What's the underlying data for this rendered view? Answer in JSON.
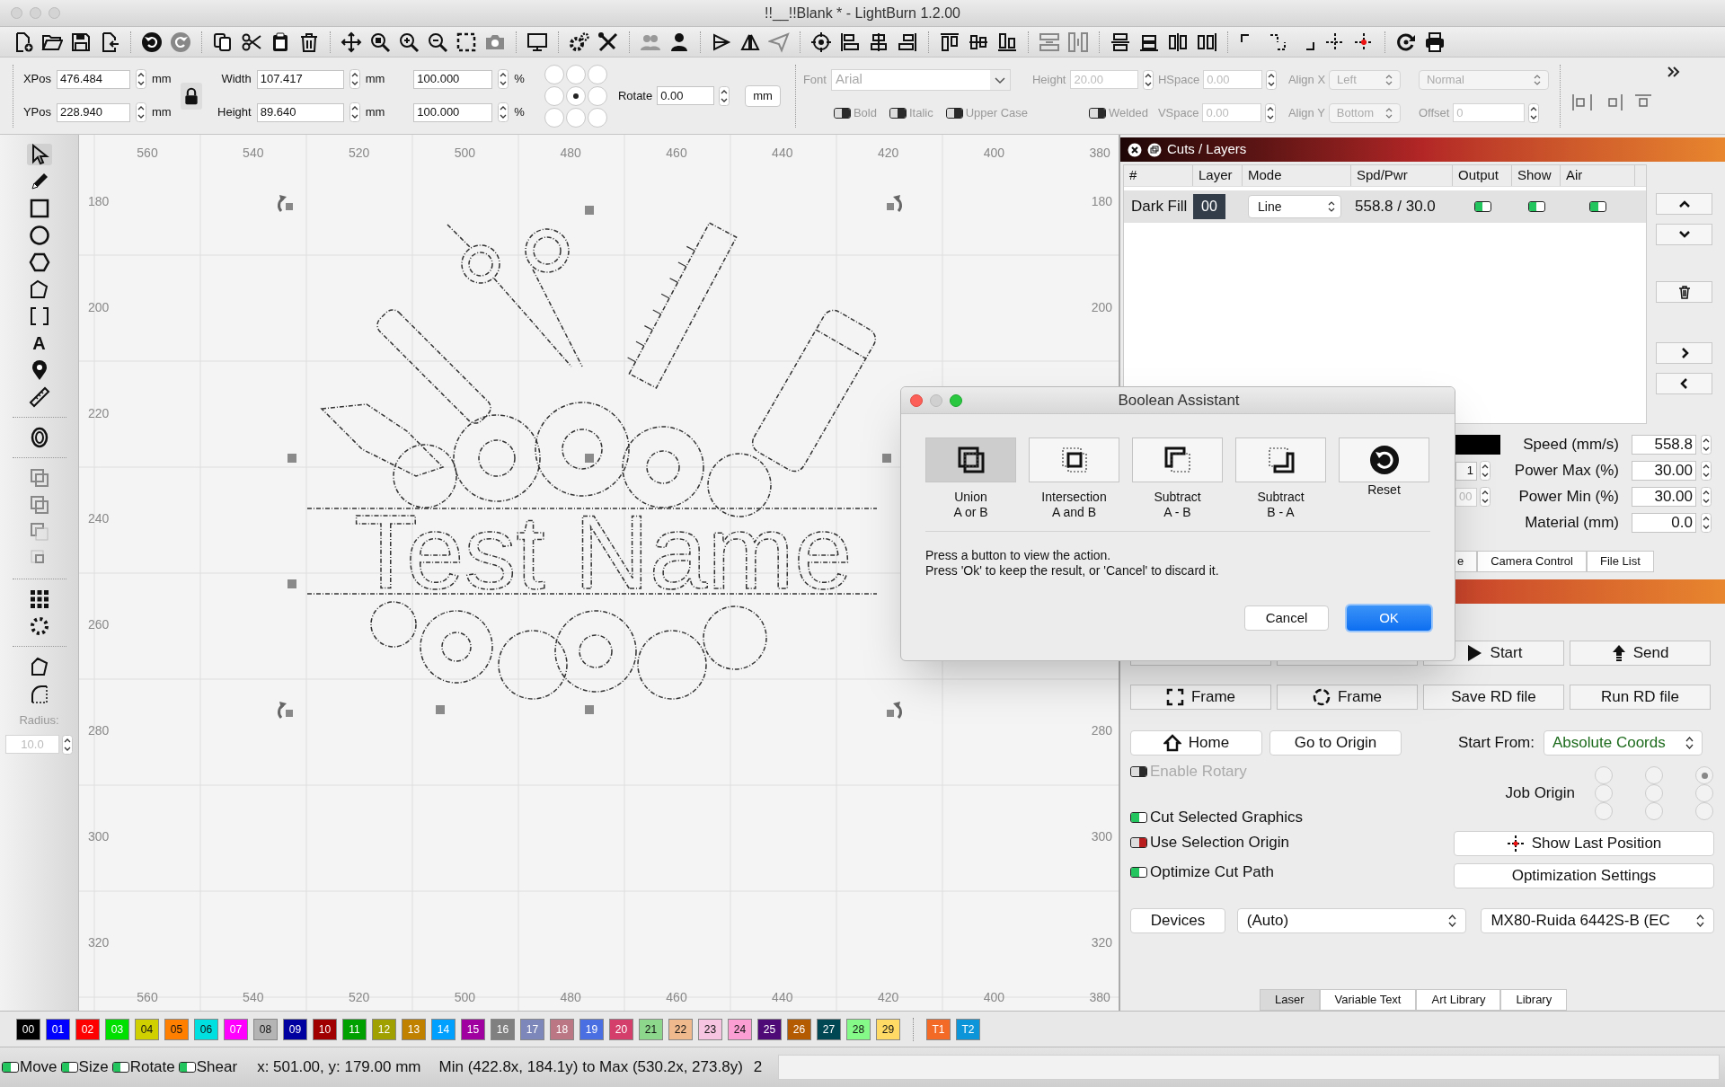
{
  "window": {
    "title": "!!__!!Blank * - LightBurn 1.2.00"
  },
  "position": [
    {
      "label": "XPos",
      "value": "476.484",
      "unit": "mm"
    },
    {
      "label": "YPos",
      "value": "228.940",
      "unit": "mm"
    }
  ],
  "size_locked": true,
  "size": [
    {
      "label": "Width",
      "value": "107.417",
      "unit": "mm",
      "scale": "100.000",
      "scale_unit": "%"
    },
    {
      "label": "Height",
      "value": "89.640",
      "unit": "mm",
      "scale": "100.000",
      "scale_unit": "%"
    }
  ],
  "origin_points": [
    {
      "selected": false
    },
    {
      "selected": false
    },
    {
      "selected": false
    },
    {
      "selected": false
    },
    {
      "selected": true
    },
    {
      "selected": false
    },
    {
      "selected": false
    },
    {
      "selected": false
    },
    {
      "selected": false
    }
  ],
  "rotate": {
    "label": "Rotate",
    "value": "0.00"
  },
  "units_button": "mm",
  "text_tools": {
    "font": {
      "label": "Font",
      "value": "Arial"
    },
    "height": {
      "label": "Height",
      "value": "20.00"
    },
    "hspace": {
      "label": "HSpace",
      "value": "0.00"
    },
    "align_x": {
      "label": "Align X",
      "value": "Left"
    },
    "style": "Normal",
    "toggles": [
      {
        "label": "Bold",
        "on": false
      },
      {
        "label": "Italic",
        "on": false
      },
      {
        "label": "Upper Case",
        "on": false
      },
      {
        "label": "Welded",
        "on": false
      }
    ],
    "vspace": {
      "label": "VSpace",
      "value": "0.00"
    },
    "align_y": {
      "label": "Align Y",
      "value": "Bottom"
    },
    "offset": {
      "label": "Offset",
      "value": "0"
    }
  },
  "left_tools": {
    "text_tool": "A",
    "radius": {
      "label": "Radius:",
      "value": "10.0"
    }
  },
  "canvas": {
    "top_ruler": [
      "560",
      "540",
      "520",
      "500",
      "480",
      "460",
      "440",
      "420",
      "400",
      "380"
    ],
    "bottom_ruler": [
      "560",
      "540",
      "520",
      "500",
      "480",
      "460",
      "440",
      "420",
      "400",
      "380"
    ],
    "left_ruler": [
      "180",
      "200",
      "220",
      "240",
      "260",
      "280",
      "300",
      "320"
    ],
    "right_ruler_upper": [
      "180",
      "200"
    ],
    "right_ruler_lower": [
      "280",
      "300",
      "320"
    ],
    "artwork_text": "Test Name"
  },
  "cuts_layers": {
    "title": "Cuts / Layers",
    "columns": [
      "#",
      "Layer",
      "Mode",
      "Spd/Pwr",
      "Output",
      "Show",
      "Air"
    ],
    "rows": [
      {
        "name": "Dark Fill",
        "layer": "00",
        "mode": "Line",
        "spd_pwr": "558.8 / 30.0",
        "output": true,
        "show": true,
        "air": true,
        "selected": true
      }
    ]
  },
  "layer_settings": {
    "passes": "1",
    "partial": "00",
    "fields": [
      {
        "label": "Speed (mm/s)",
        "value": "558.8"
      },
      {
        "label": "Power Max (%)",
        "value": "30.00"
      },
      {
        "label": "Power Min (%)",
        "value": "30.00"
      },
      {
        "label": "Material (mm)",
        "value": "0.0"
      }
    ]
  },
  "panel_tabs": [
    {
      "label": "e",
      "selected": false
    },
    {
      "label": "Camera Control",
      "selected": false
    },
    {
      "label": "File List",
      "selected": false
    }
  ],
  "laser": {
    "row1": [
      {
        "kind": "start",
        "label": "Start"
      },
      {
        "kind": "send",
        "label": "Send"
      }
    ],
    "row2": [
      {
        "kind": "frame-rect",
        "label": "Frame"
      },
      {
        "kind": "frame-circle",
        "label": "Frame"
      },
      {
        "kind": "plain",
        "label": "Save RD file"
      },
      {
        "kind": "plain",
        "label": "Run RD file"
      }
    ],
    "home": "Home",
    "go_to_origin": "Go to Origin",
    "start_from": {
      "label": "Start From:",
      "value": "Absolute Coords"
    },
    "enable_rotary": {
      "label": "Enable Rotary",
      "on": false,
      "disabled": true
    },
    "job_origin": {
      "label": "Job Origin",
      "points": [
        {
          "selected": false
        },
        {
          "selected": false
        },
        {
          "selected": true
        },
        {
          "selected": false
        },
        {
          "selected": false
        },
        {
          "selected": false
        },
        {
          "selected": false
        },
        {
          "selected": false
        },
        {
          "selected": false
        }
      ]
    },
    "options": [
      {
        "label": "Cut Selected Graphics",
        "on": true
      },
      {
        "label": "Use Selection Origin",
        "on": false
      },
      {
        "label": "Optimize Cut Path",
        "on": true
      }
    ],
    "show_last_position": "Show Last Position",
    "optimization_settings": "Optimization Settings",
    "devices": "Devices",
    "port": "(Auto)",
    "device": "MX80-Ruida 6442S-B (EC"
  },
  "bottom_tabs": [
    {
      "label": "Laser",
      "selected": true
    },
    {
      "label": "Variable Text",
      "selected": false
    },
    {
      "label": "Art Library",
      "selected": false
    },
    {
      "label": "Library",
      "selected": false
    }
  ],
  "palette": [
    {
      "label": "00",
      "color": "#000000"
    },
    {
      "label": "01",
      "color": "#0000ff"
    },
    {
      "label": "02",
      "color": "#ff0000"
    },
    {
      "label": "03",
      "color": "#00e000"
    },
    {
      "label": "04",
      "color": "#d0d000"
    },
    {
      "label": "05",
      "color": "#ff8000"
    },
    {
      "label": "06",
      "color": "#00e0e0"
    },
    {
      "label": "07",
      "color": "#ff00ff"
    },
    {
      "label": "08",
      "color": "#b4b4b4"
    },
    {
      "label": "09",
      "color": "#0000a0"
    },
    {
      "label": "10",
      "color": "#a00000"
    },
    {
      "label": "11",
      "color": "#00a000"
    },
    {
      "label": "12",
      "color": "#a0a000"
    },
    {
      "label": "13",
      "color": "#c08000"
    },
    {
      "label": "14",
      "color": "#00a0ff"
    },
    {
      "label": "15",
      "color": "#a000a0"
    },
    {
      "label": "16",
      "color": "#808080"
    },
    {
      "label": "17",
      "color": "#7d87b9"
    },
    {
      "label": "18",
      "color": "#bb7784"
    },
    {
      "label": "19",
      "color": "#4a6fe3"
    },
    {
      "label": "20",
      "color": "#d33f6a"
    },
    {
      "label": "21",
      "color": "#8cd78c"
    },
    {
      "label": "22",
      "color": "#f0b98d"
    },
    {
      "label": "23",
      "color": "#f6c4e1"
    },
    {
      "label": "24",
      "color": "#fa9ed4"
    },
    {
      "label": "25",
      "color": "#500a78"
    },
    {
      "label": "26",
      "color": "#b45a00"
    },
    {
      "label": "27",
      "color": "#004754"
    },
    {
      "label": "28",
      "color": "#86fa88"
    },
    {
      "label": "29",
      "color": "#ffdb66"
    }
  ],
  "tool_layers": [
    {
      "label": "T1",
      "color": "#f36926"
    },
    {
      "label": "T2",
      "color": "#0c96d9"
    }
  ],
  "status_bar": {
    "toggles": [
      {
        "label": "Move",
        "on": true
      },
      {
        "label": "Size",
        "on": true
      },
      {
        "label": "Rotate",
        "on": true
      },
      {
        "label": "Shear",
        "on": true
      }
    ],
    "cursor": "x: 501.00, y: 179.00 mm",
    "bounds": "Min (422.8x, 184.1y) to Max (530.2x, 273.8y)",
    "count": "2"
  },
  "dialog": {
    "title": "Boolean Assistant",
    "operations": [
      {
        "kind": "union",
        "lines": [
          "Union",
          "A or B"
        ],
        "selected": true
      },
      {
        "kind": "intersection",
        "lines": [
          "Intersection",
          "A and B"
        ],
        "selected": false
      },
      {
        "kind": "subtract-ab",
        "lines": [
          "Subtract",
          "A - B"
        ],
        "selected": false
      },
      {
        "kind": "subtract-ba",
        "lines": [
          "Subtract",
          "B - A"
        ],
        "selected": false
      },
      {
        "kind": "reset",
        "lines": [
          "Reset"
        ],
        "selected": false
      }
    ],
    "message": [
      "Press a button to view the action.",
      "Press 'Ok' to keep the result, or 'Cancel' to discard it."
    ],
    "cancel": "Cancel",
    "ok": "OK"
  }
}
